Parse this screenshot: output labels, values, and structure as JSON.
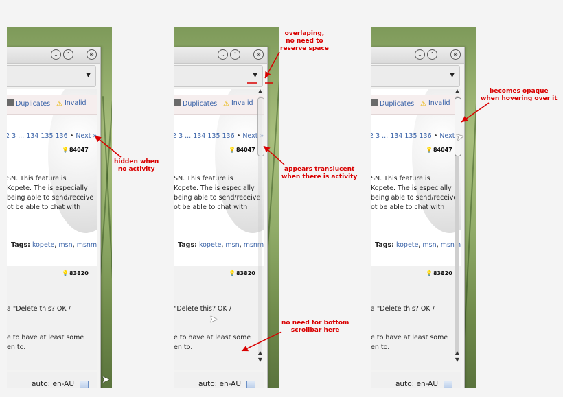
{
  "panels": [
    {
      "titlebar_buttons": [
        "⌄",
        "⌃",
        "⊗"
      ],
      "tabs": [
        {
          "label": "Duplicates",
          "icon": "copy-icon"
        },
        {
          "label": "Invalid",
          "icon": "warning-icon"
        }
      ],
      "pager": {
        "pages": "2 3 ... 134 135 136",
        "sep": "•",
        "next": "Next »"
      },
      "score1": "84047",
      "body_lines": [
        "SN. This feature is",
        "Kopete. The is especially",
        "being able to send/receive",
        "ot be able to chat with"
      ],
      "tags_label": "Tags:",
      "tags": [
        "kopete",
        "msn",
        "msnm"
      ],
      "score2": "83820",
      "card2_lines": [
        "a \"Delete this? OK /",
        "e to have at least some",
        "en to."
      ],
      "status_text": "auto: en-AU",
      "scrollbar_state": "hidden"
    },
    {
      "titlebar_buttons": [
        "⌄",
        "⌃",
        "⊗"
      ],
      "tabs": [
        {
          "label": "Duplicates",
          "icon": "copy-icon"
        },
        {
          "label": "Invalid",
          "icon": "warning-icon"
        }
      ],
      "pager": {
        "pages": "2 3 ... 134 135 136",
        "sep": "•",
        "next": "Next »"
      },
      "score1": "84047",
      "body_lines": [
        "SN. This feature is",
        "Kopete. The is especially",
        "being able to send/receive",
        "ot be able to chat with"
      ],
      "tags_label": "Tags:",
      "tags": [
        "kopete",
        "msn",
        "msnm"
      ],
      "score2": "83820",
      "card2_lines": [
        "\"Delete this? OK /",
        "e to have at least some",
        "en to."
      ],
      "status_text": "auto: en-AU",
      "scrollbar_state": "translucent"
    },
    {
      "titlebar_buttons": [
        "⌄",
        "⌃",
        "⊗"
      ],
      "tabs": [
        {
          "label": "Duplicates",
          "icon": "copy-icon"
        },
        {
          "label": "Invalid",
          "icon": "warning-icon"
        }
      ],
      "pager": {
        "pages": "2 3 ... 134 135 136",
        "sep": "•",
        "next": "Next »"
      },
      "score1": "84047",
      "body_lines": [
        "SN. This feature is",
        "Kopete. The is especially",
        "being able to send/receive",
        "ot be able to chat with"
      ],
      "tags_label": "Tags:",
      "tags": [
        "kopete",
        "msn",
        "msnm"
      ],
      "score2": "83820",
      "card2_lines": [
        "a \"Delete this? OK /",
        "e to have at least some",
        "en to."
      ],
      "status_text": "auto: en-AU",
      "scrollbar_state": "opaque"
    }
  ],
  "annotations": {
    "hidden": "hidden when\nno activity",
    "overlapping": "overlaping,\nno need to\nreserve space",
    "translucent": "appears translucent\nwhen there is activity",
    "no_bottom": "no need for bottom\nscrollbar here",
    "opaque": "becomes opaque\nwhen hovering over it"
  },
  "colors": {
    "annotation": "#d90000",
    "link": "#3a63a8",
    "score_bulb": "#e8b400"
  }
}
